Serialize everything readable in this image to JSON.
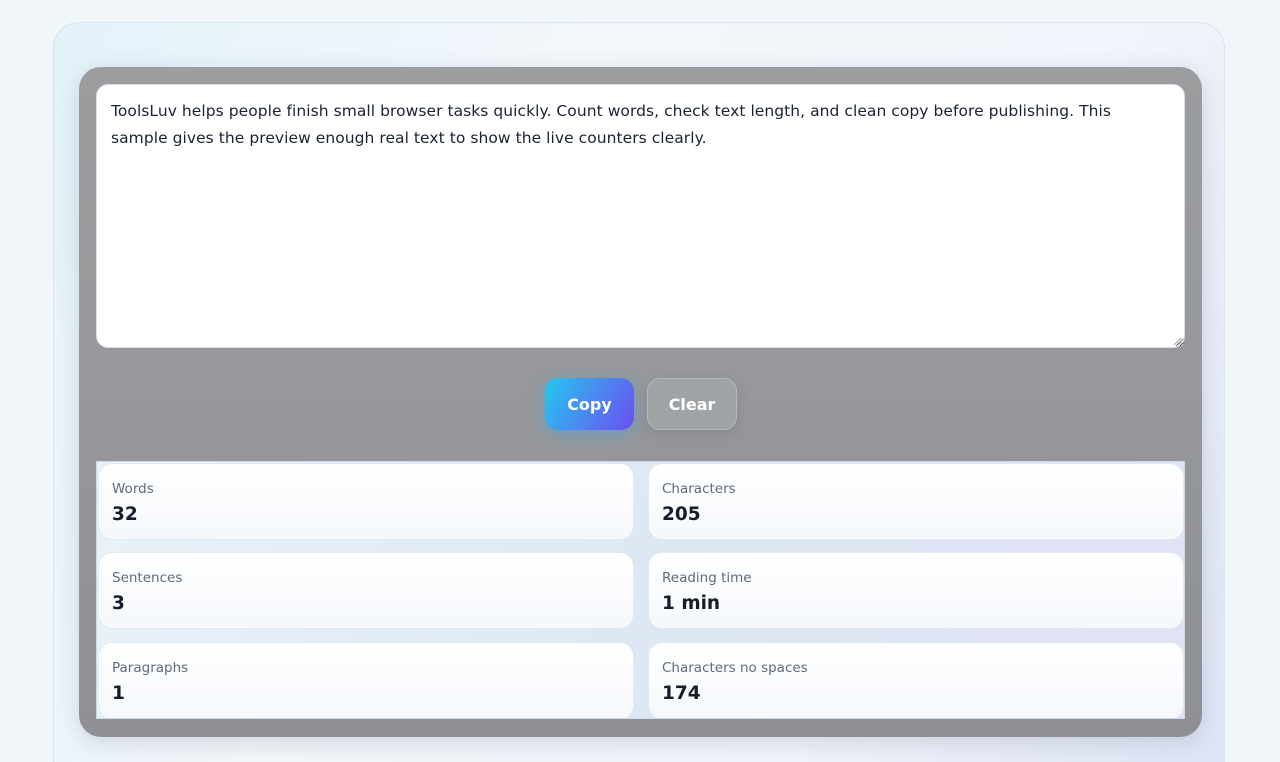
{
  "editor": {
    "text": "ToolsLuv helps people finish small browser tasks quickly. Count words, check text length, and clean copy before publishing. This sample gives the preview enough real text to show the live counters clearly."
  },
  "actions": {
    "copy_label": "Copy",
    "clear_label": "Clear"
  },
  "stats": [
    {
      "label": "Words",
      "value": "32"
    },
    {
      "label": "Characters",
      "value": "205"
    },
    {
      "label": "Sentences",
      "value": "3"
    },
    {
      "label": "Reading time",
      "value": "1 min"
    },
    {
      "label": "Paragraphs",
      "value": "1"
    },
    {
      "label": "Characters no spaces",
      "value": "174"
    }
  ],
  "colors": {
    "copy_gradient_start": "#22c9ee",
    "copy_gradient_end": "#6a4ef0",
    "panel": "#97989b"
  }
}
